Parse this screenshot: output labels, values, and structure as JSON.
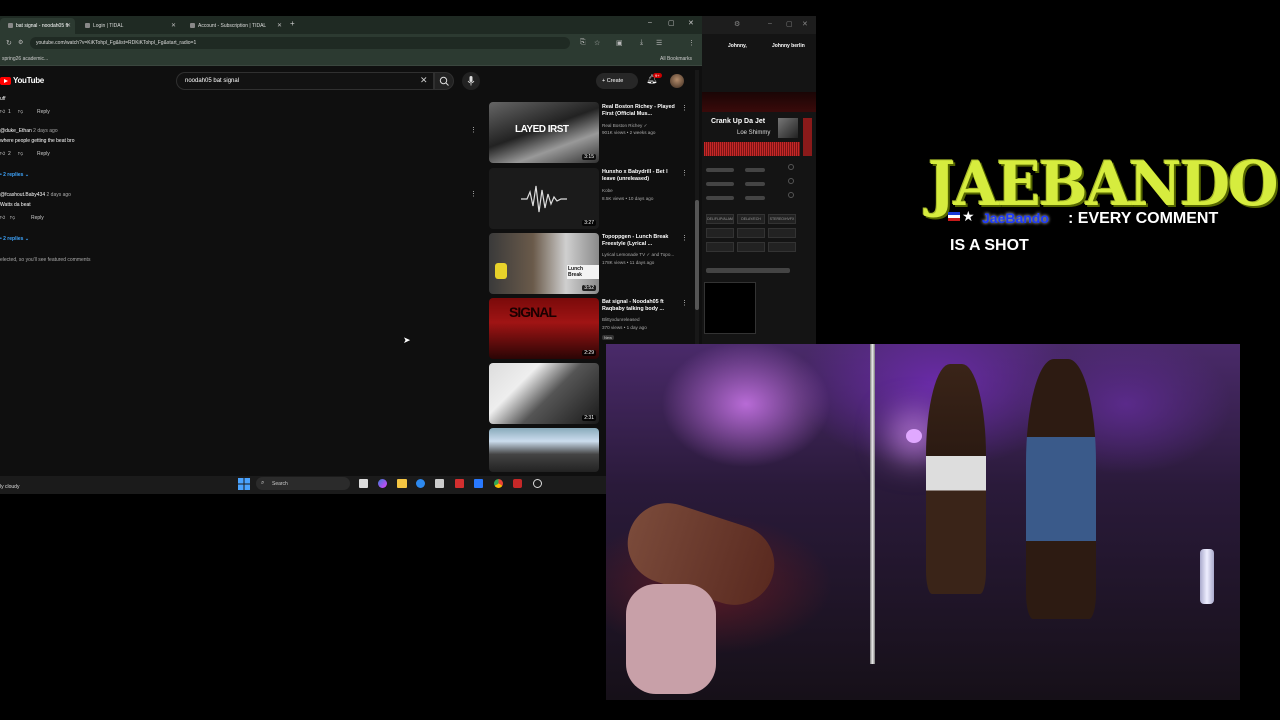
{
  "browser": {
    "tabs": [
      {
        "label": "bat signal - noodah05 ft"
      },
      {
        "label": "Login | TIDAL"
      },
      {
        "label": "Account - Subscription | TIDAL"
      }
    ],
    "url": "youtube.com/watch?v=KiKTohpl_Fg&list=RDKiKTohpl_Fg&start_radio=1",
    "bookmark_left": "spring26 academic...",
    "bookmark_right": "All Bookmarks"
  },
  "youtube": {
    "logo": "YouTube",
    "search_value": "noodah05 bat signal",
    "create_label": "Create",
    "notif_count": "9+"
  },
  "comments": {
    "c0_text": "uff",
    "c0_likes": "1",
    "reply_label": "Reply",
    "c1_author": "@duke_Ethan",
    "c1_time": "2 days ago",
    "c1_text": "where people getting the beat bro",
    "c1_likes": "2",
    "c1_replies": "2 replies",
    "c2_author": "@fcashout.Baby434",
    "c2_time": "2 days ago",
    "c2_text": "Watts da beat",
    "c2_replies": "2 replies",
    "footer_note": "elected, so you'll see featured comments"
  },
  "sidebar": {
    "videos": [
      {
        "title": "Real Boston Richey - Played First (Official Mus...",
        "channel": "Real Boston Richey ✓",
        "meta": "901K views • 2 weeks ago",
        "duration": "3:15",
        "thumb_text": "LAYED IRST"
      },
      {
        "title": "Hunxho x Babydrill - Bet I leave (unreleased)",
        "channel": "Kobe",
        "meta": "8.5K views • 10 days ago",
        "duration": "3:27",
        "thumb_text": ""
      },
      {
        "title": "Topoppgen - Lunch Break Freestyle (Lyrical ...",
        "channel": "Lyrical Lemonade TV ✓ and Topo...",
        "meta": "178K views • 11 days ago",
        "duration": "3:52",
        "thumb_text": "Lunch Break"
      },
      {
        "title": "Bat signal - Noodah05 ft Raqbaby talking body ...",
        "channel": "Blittyxdunreleased",
        "meta": "370 views • 1 day ago",
        "duration": "2:29",
        "thumb_text": "SIGNAL"
      },
      {
        "title": "",
        "channel": "",
        "meta": "",
        "duration": "2:31",
        "thumb_text": ""
      },
      {
        "title": "",
        "channel": "",
        "meta": "",
        "duration": "",
        "thumb_text": ""
      }
    ],
    "new_badge": "New"
  },
  "taskbar": {
    "weather": "ly cloudy",
    "search_label": "Search"
  },
  "mixer": {
    "name_left": "Johnny,",
    "name_right": "Johnny berlin",
    "track_title": "Crank Up Da Jet",
    "track_artist": "Loe Shimmy",
    "button_labels": [
      "DEL/FLIP/ALAM",
      "DELAY/ECH",
      "STEREO/HVFX"
    ]
  },
  "overlay": {
    "brand": "JAEBANDO",
    "handle": "JaeBando",
    "tagline_line1": ": EVERY COMMENT",
    "tagline_line2": "IS A SHOT"
  },
  "colors": {
    "yt_red": "#ff0000",
    "brand_yellow": "#d6ec3e",
    "link_blue": "#3ea6ff",
    "webcam_purple": "#6a2ba8"
  }
}
